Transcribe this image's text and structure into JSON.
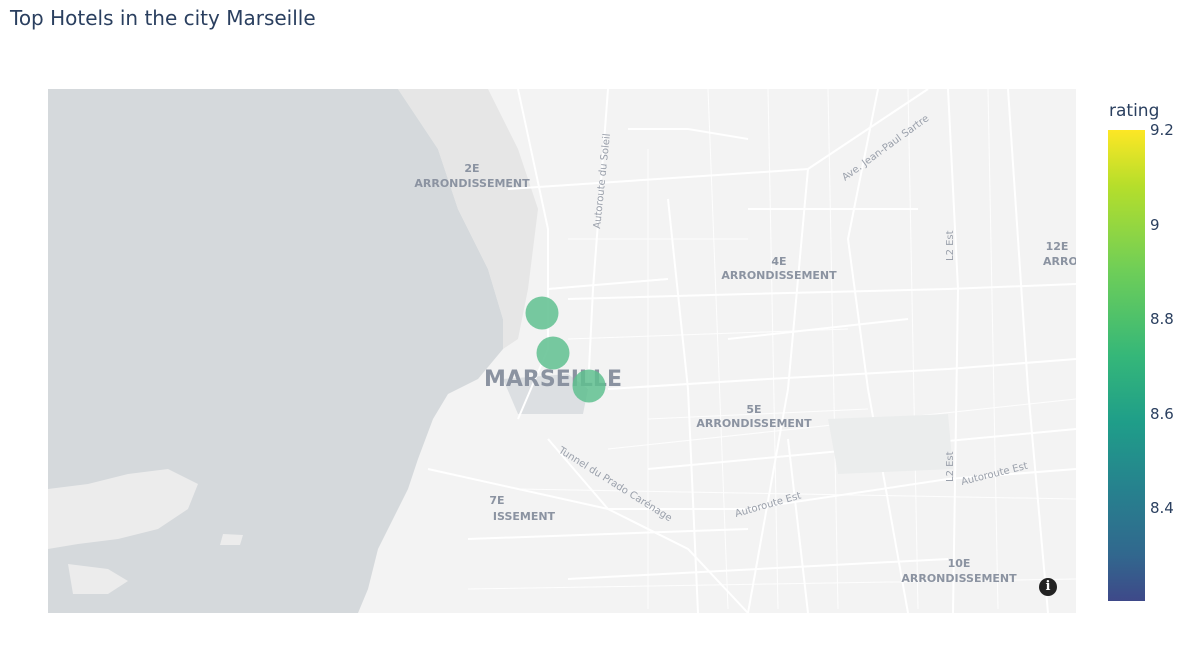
{
  "title": "Top Hotels in the city Marseille",
  "map": {
    "city_label": "MARSEILLE",
    "district_labels": [
      {
        "line1": "2E",
        "line2": "ARRONDISSEMENT"
      },
      {
        "line1": "4E",
        "line2": "ARRONDISSEMENT"
      },
      {
        "line1": "5E",
        "line2": "ARRONDISSEMENT"
      },
      {
        "line1": "7E",
        "line2": "ISSEMENT"
      },
      {
        "line1": "10E",
        "line2": "ARRONDISSEMENT"
      },
      {
        "line1": "12E",
        "line2": "ARRONDISS"
      }
    ],
    "road_labels": [
      "Autoroute du Soleil",
      "Ave. Jean-Paul Sartre",
      "L2 Est",
      "L2 Est",
      "Autoroute Est",
      "Autoroute Est",
      "Tunnel du Prado Carénage"
    ],
    "marker_color": "#5fbf8f",
    "hotels": [
      {
        "rating": 8.8
      },
      {
        "rating": 8.8
      },
      {
        "rating": 8.8
      }
    ]
  },
  "colorbar": {
    "title": "rating",
    "ticks": [
      "9.2",
      "9",
      "8.8",
      "8.6",
      "8.4"
    ],
    "colors": [
      "#fde725",
      "#6ece58",
      "#1f9e89",
      "#31688e",
      "#3e4989"
    ]
  },
  "info_icon": "info-icon"
}
